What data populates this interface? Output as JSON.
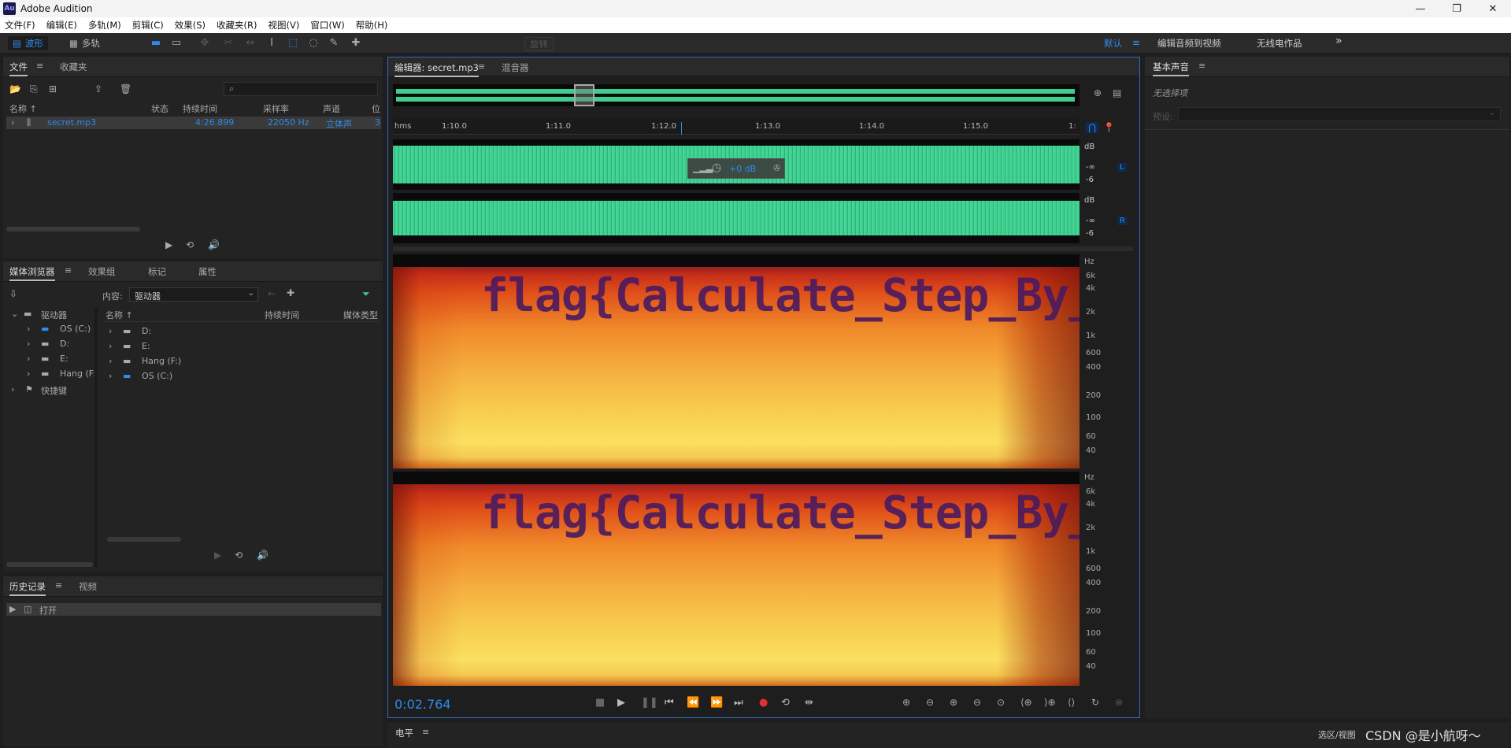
{
  "window": {
    "app_title": "Adobe Audition",
    "logo": "Au",
    "controls": [
      "—",
      "❐",
      "✕"
    ]
  },
  "menu": [
    "文件(F)",
    "编辑(E)",
    "多轨(M)",
    "剪辑(C)",
    "效果(S)",
    "收藏夹(R)",
    "视图(V)",
    "窗口(W)",
    "帮助(H)"
  ],
  "toolbar": {
    "waveform_label": "波形",
    "multitrack_label": "多轨",
    "rotate_label": "旋转",
    "workspace_default": "默认",
    "workspace_menu_icon": "≡",
    "workspace_edit_video": "编辑音频到视频",
    "workspace_radio": "无线电作品",
    "more_icon": "»"
  },
  "files_panel": {
    "tab_files": "文件",
    "tab_favorites": "收藏夹",
    "search_icon": "⌕",
    "columns": [
      "名称 ↑",
      "状态",
      "持续时间",
      "采样率",
      "声道",
      "位"
    ],
    "rows": [
      {
        "name": "secret.mp3",
        "status": "",
        "duration": "4:26.899",
        "sample_rate": "22050 Hz",
        "channels": "立体声",
        "bits": "3"
      }
    ]
  },
  "media_panel": {
    "tabs": [
      "媒体浏览器",
      "效果组",
      "标记",
      "属性"
    ],
    "content_label": "内容:",
    "content_value": "驱动器",
    "left_tree": [
      {
        "label": "驱动器",
        "level": 0
      },
      {
        "label": "OS (C:)",
        "level": 1
      },
      {
        "label": "D:",
        "level": 1
      },
      {
        "label": "E:",
        "level": 1
      },
      {
        "label": "Hang (F:",
        "level": 1
      },
      {
        "label": "快捷键",
        "level": 0
      }
    ],
    "columns": [
      "名称 ↑",
      "持续时间",
      "媒体类型"
    ],
    "items": [
      "D:",
      "E:",
      "Hang (F:)",
      "OS (C:)"
    ]
  },
  "history_panel": {
    "tabs": [
      "历史记录",
      "视频"
    ],
    "items": [
      "打开"
    ]
  },
  "editor": {
    "tab_editor": "编辑器: secret.mp3",
    "tab_mixer": "混音器",
    "ruler_unit": "hms",
    "ruler_ticks": [
      "1:10.0",
      "1:11.0",
      "1:12.0",
      "1:13.0",
      "1:14.0",
      "1:15.0",
      "1:"
    ],
    "hud_db": "+0 dB",
    "channel_L": "L",
    "channel_R": "R",
    "db_labels": [
      "dB",
      "-∞",
      "-6"
    ],
    "hz_labels": [
      "Hz",
      "6k",
      "4k",
      "2k",
      "1k",
      "600",
      "400",
      "200",
      "100",
      "60",
      "40"
    ],
    "spectrogram_text": "flag{Calculate_Step_By_Step}",
    "time_display": "0:02.764"
  },
  "essential_sound": {
    "title": "基本声音",
    "no_selection": "无选择项",
    "preset_label": "预设:"
  },
  "bottom": {
    "level_label": "电平",
    "selection_label": "选区/视图",
    "watermark": "CSDN @是小航呀～"
  },
  "colors": {
    "accent": "#2d8ceb",
    "waveform": "#3ecf8e",
    "panel_bg": "#232323",
    "editor_border": "#2d6cc0"
  }
}
